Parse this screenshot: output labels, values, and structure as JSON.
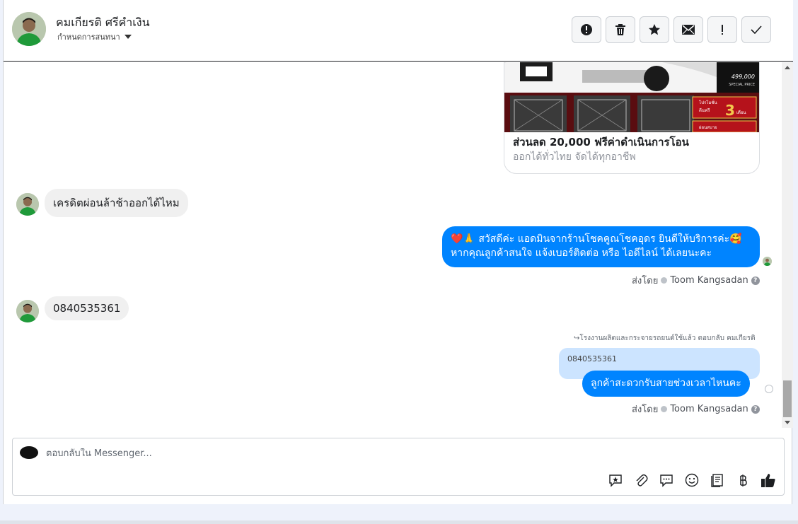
{
  "header": {
    "contact_name": "คมเกียรติ ศรีคำเงิน",
    "conversation_label": "กำหนดการสนทนา",
    "toolbar": [
      {
        "name": "spam",
        "icon": "alert-circle-icon"
      },
      {
        "name": "delete",
        "icon": "trash-icon"
      },
      {
        "name": "star",
        "icon": "star-icon"
      },
      {
        "name": "mark-unread",
        "icon": "envelope-icon"
      },
      {
        "name": "important",
        "icon": "exclamation-icon"
      },
      {
        "name": "done",
        "icon": "checkmark-icon"
      }
    ]
  },
  "thread": {
    "card": {
      "title": "ส่วนลด 20,000 ฟรีค่าดำเนินการโอน",
      "subtitle": "ออกได้ทั่วไทย จัดได้ทุกอาชีพ",
      "image_text": {
        "price": "499,000",
        "special": "SPECIAL PRICE",
        "promo1": "โปรโมชั่น",
        "promo2": "ดีนฟรี",
        "promo_num": "3",
        "promo_unit": "เดือน",
        "promo3": "ผ่อนสบาย"
      }
    },
    "msg1": "เครดิตผ่อนล้าช้าออกได้ไหม",
    "reply1_line1": "❤️🙏 สวัสดีค่ะ แอดมินจากร้านโชคคูณโชคอุดร ยินดีให้บริการค่ะ🥰",
    "reply1_line2": "หากคุณลูกค้าสนใจ แจ้งเบอร์ติดต่อ หรือ ไอดีไลน์ ได้เลยนะคะ",
    "sent_by_label": "ส่งโดย",
    "sender_name": "Toom Kangsadan",
    "help_glyph": "?",
    "msg2": "0840535361",
    "reply_note": "โรงงานผลิตและกระจายรถยนต์ใช้แล้ว ตอบกลับ คมเกียรติ",
    "quoted_text": "0840535361",
    "reply2": "ลูกค้าสะดวกรับสายช่วงเวลาไหนคะ"
  },
  "composer": {
    "placeholder": "ตอบกลับใน Messenger...",
    "tools": [
      "saved-reply-icon",
      "attachment-icon",
      "chat-bubbles-icon",
      "emoji-icon",
      "document-icon",
      "baht-icon",
      "thumbs-up-icon"
    ]
  },
  "colors": {
    "accent": "#0084ff",
    "bubble_in": "#f0f0f0",
    "quoted": "#cce4ff"
  }
}
